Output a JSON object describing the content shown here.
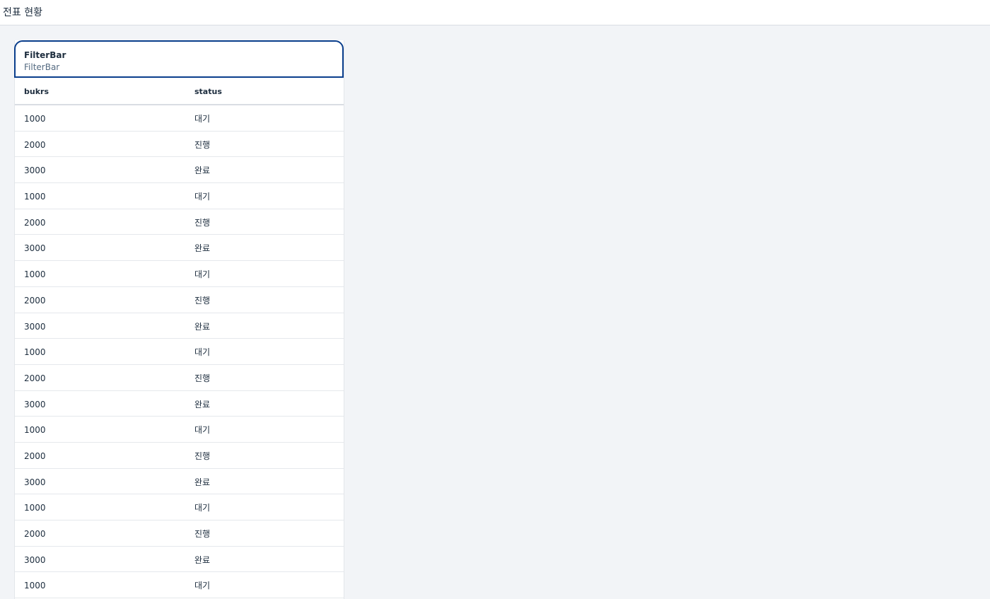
{
  "header": {
    "title": "전표 현황"
  },
  "filter_bar": {
    "title": "FilterBar",
    "subtitle": "FilterBar"
  },
  "table": {
    "columns": [
      "bukrs",
      "status"
    ],
    "rows": [
      [
        "1000",
        "대기"
      ],
      [
        "2000",
        "진행"
      ],
      [
        "3000",
        "완료"
      ],
      [
        "1000",
        "대기"
      ],
      [
        "2000",
        "진행"
      ],
      [
        "3000",
        "완료"
      ],
      [
        "1000",
        "대기"
      ],
      [
        "2000",
        "진행"
      ],
      [
        "3000",
        "완료"
      ],
      [
        "1000",
        "대기"
      ],
      [
        "2000",
        "진행"
      ],
      [
        "3000",
        "완료"
      ],
      [
        "1000",
        "대기"
      ],
      [
        "2000",
        "진행"
      ],
      [
        "3000",
        "완료"
      ],
      [
        "1000",
        "대기"
      ],
      [
        "2000",
        "진행"
      ],
      [
        "3000",
        "완료"
      ],
      [
        "1000",
        "대기"
      ]
    ]
  }
}
